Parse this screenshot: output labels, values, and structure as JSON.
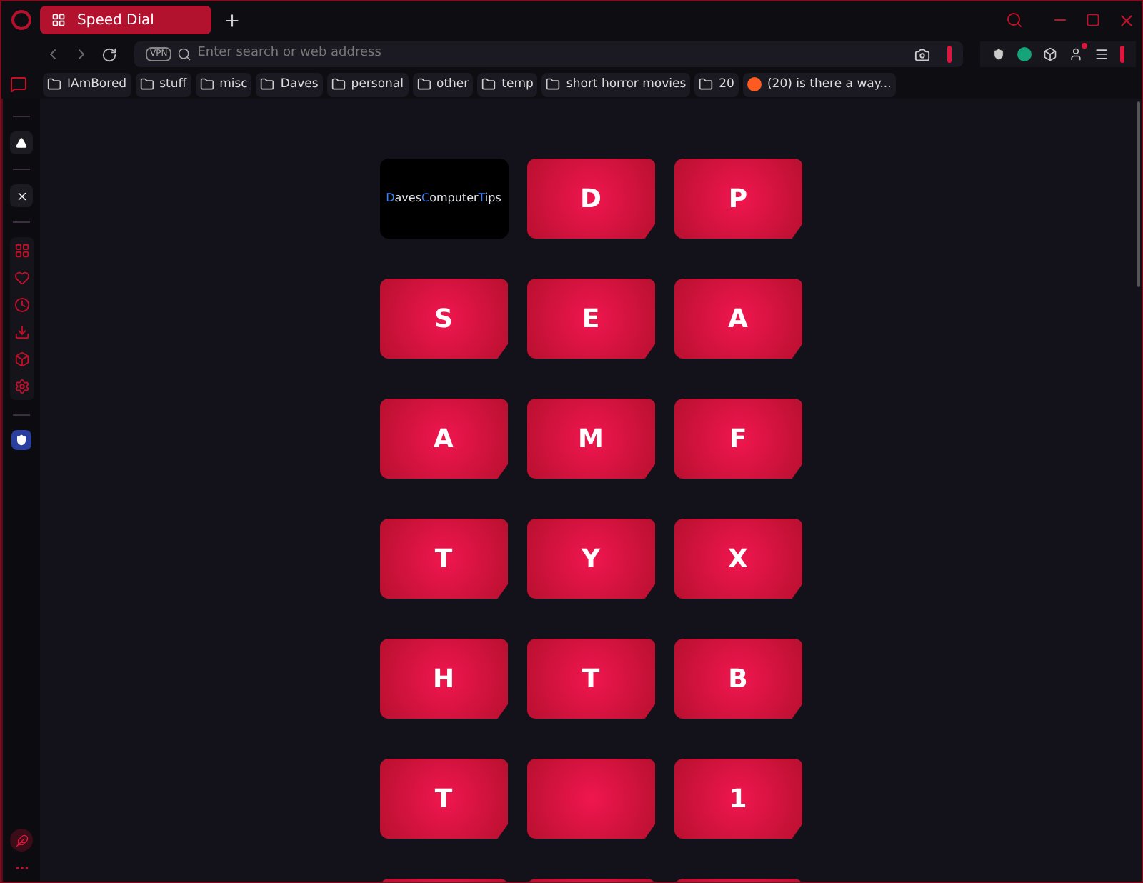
{
  "tab": {
    "title": "Speed Dial",
    "selected": true
  },
  "address_bar": {
    "vpn_badge": "VPN",
    "placeholder": "Enter search or web address"
  },
  "bookmarks": [
    {
      "kind": "folder",
      "label": "IAmBored"
    },
    {
      "kind": "folder",
      "label": "stuff"
    },
    {
      "kind": "folder",
      "label": "misc"
    },
    {
      "kind": "folder",
      "label": "Daves"
    },
    {
      "kind": "folder",
      "label": "personal"
    },
    {
      "kind": "folder",
      "label": "other"
    },
    {
      "kind": "folder",
      "label": "temp"
    },
    {
      "kind": "folder",
      "label": "short horror movies"
    },
    {
      "kind": "folder",
      "label": "20"
    },
    {
      "kind": "site",
      "label": "(20) is there a way..."
    }
  ],
  "speed_dial": [
    {
      "kind": "logo",
      "parts": [
        {
          "text": "D",
          "accent": true
        },
        {
          "text": "aves",
          "accent": false
        },
        {
          "text": "C",
          "accent": true
        },
        {
          "text": "omputer",
          "accent": false
        },
        {
          "text": "T",
          "accent": true
        },
        {
          "text": "ips",
          "accent": false
        }
      ]
    },
    {
      "kind": "letter",
      "label": "D"
    },
    {
      "kind": "letter",
      "label": "P"
    },
    {
      "kind": "letter",
      "label": "S"
    },
    {
      "kind": "letter",
      "label": "E"
    },
    {
      "kind": "letter",
      "label": "A"
    },
    {
      "kind": "letter",
      "label": "A"
    },
    {
      "kind": "letter",
      "label": "M"
    },
    {
      "kind": "letter",
      "label": "F"
    },
    {
      "kind": "letter",
      "label": "T"
    },
    {
      "kind": "letter",
      "label": "Y"
    },
    {
      "kind": "letter",
      "label": "X"
    },
    {
      "kind": "letter",
      "label": "H"
    },
    {
      "kind": "letter",
      "label": "T"
    },
    {
      "kind": "letter",
      "label": "B"
    },
    {
      "kind": "letter",
      "label": "T"
    },
    {
      "kind": "letter"
    },
    {
      "kind": "letter",
      "label": "1"
    },
    {
      "kind": "letter"
    },
    {
      "kind": "letter"
    },
    {
      "kind": "letter"
    }
  ]
}
